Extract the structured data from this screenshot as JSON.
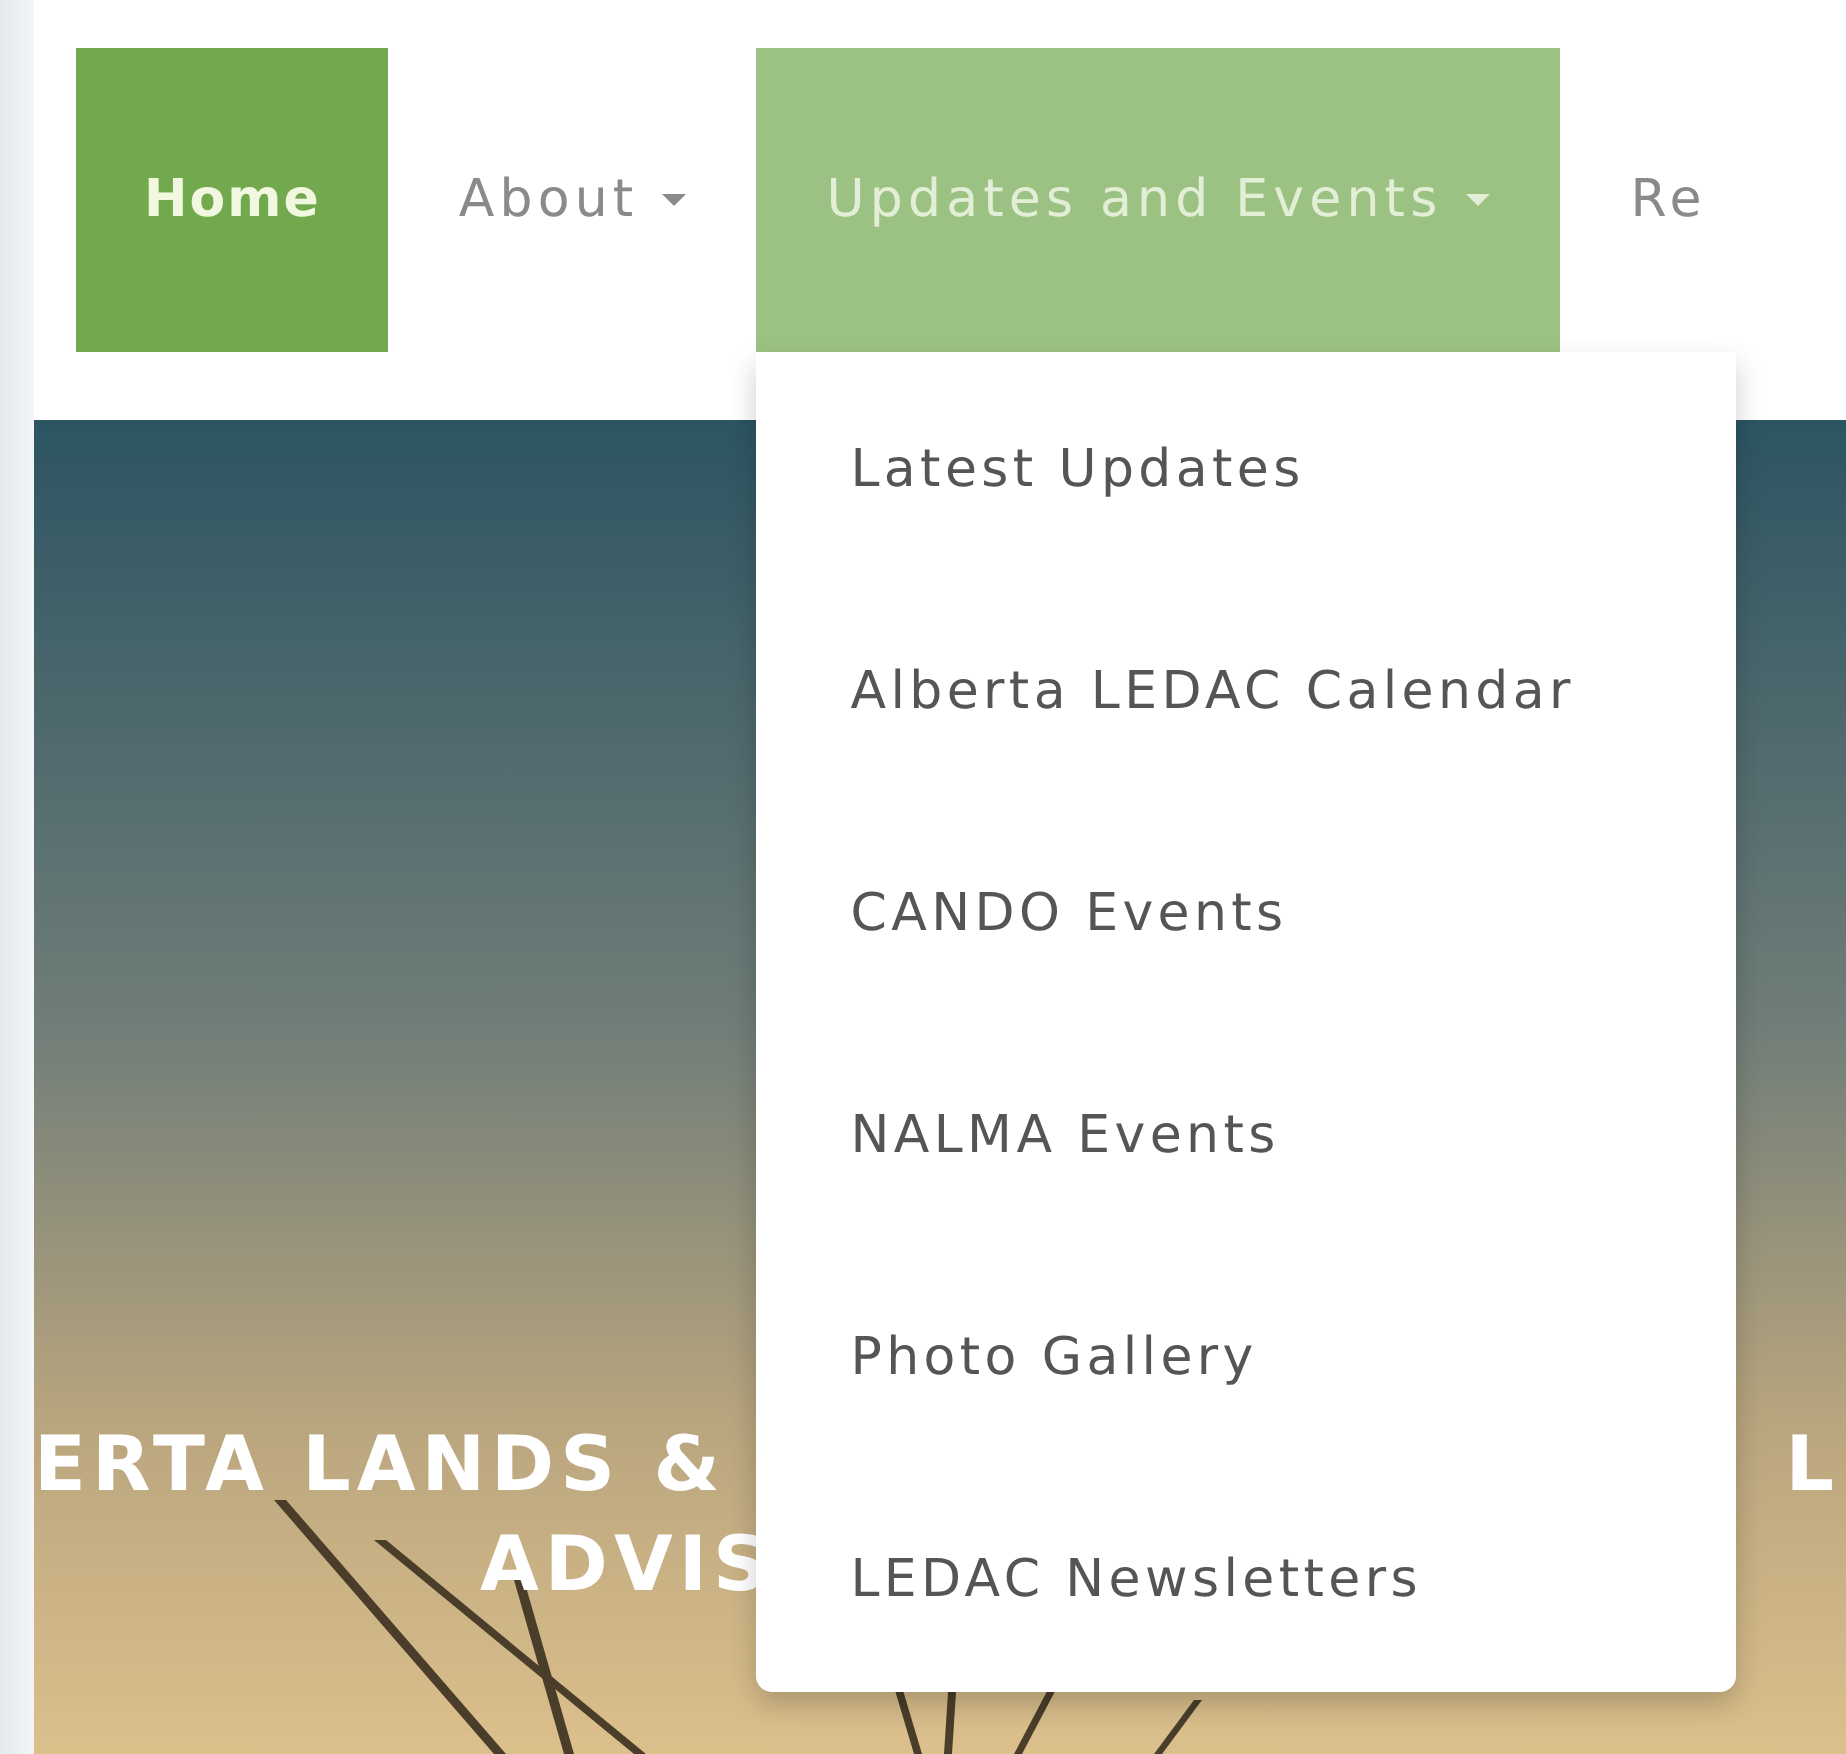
{
  "nav": {
    "items": [
      {
        "label": "Home",
        "dropdown": false,
        "selected": true,
        "expanded": false
      },
      {
        "label": "About",
        "dropdown": true,
        "selected": false,
        "expanded": false
      },
      {
        "label": "Updates and Events",
        "dropdown": true,
        "selected": false,
        "expanded": true,
        "menu": [
          "Latest Updates",
          "Alberta LEDAC Calendar",
          "CANDO Events",
          "NALMA Events",
          "Photo Gallery",
          "LEDAC Newsletters"
        ]
      },
      {
        "label": "Re",
        "dropdown": false,
        "selected": false,
        "expanded": false
      }
    ]
  },
  "hero": {
    "title_line_1_left": "ERTA LANDS &",
    "title_line_1_right": "L",
    "title_line_2": "ADVIS"
  }
}
